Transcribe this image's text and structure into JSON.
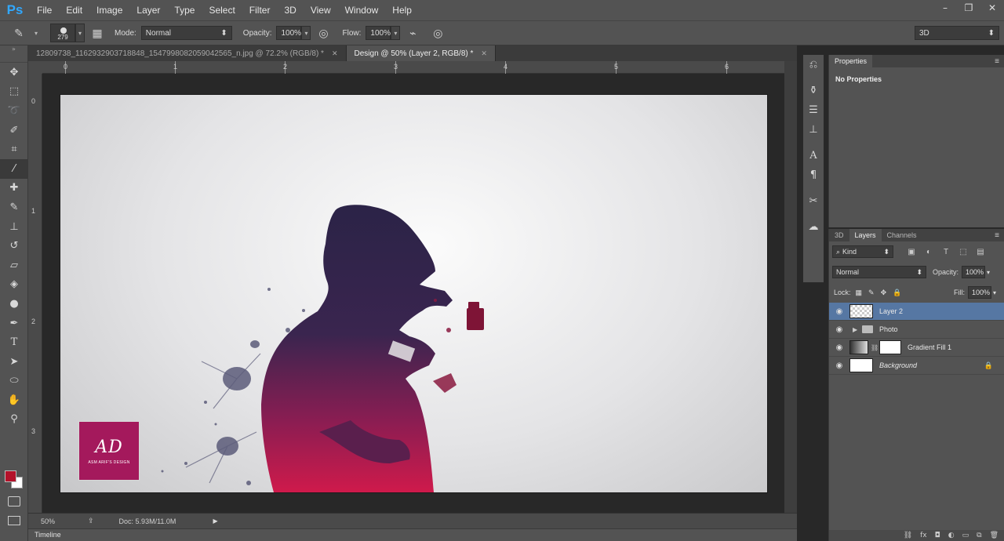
{
  "app": {
    "logo": "Ps"
  },
  "menu": [
    "File",
    "Edit",
    "Image",
    "Layer",
    "Type",
    "Select",
    "Filter",
    "3D",
    "View",
    "Window",
    "Help"
  ],
  "window_controls": {
    "minimize": "–",
    "restore": "❐",
    "close": "✕"
  },
  "options": {
    "brush_size": "279",
    "mode_label": "Mode:",
    "mode_value": "Normal",
    "opacity_label": "Opacity:",
    "opacity_value": "100%",
    "flow_label": "Flow:",
    "flow_value": "100%",
    "workspace": "3D"
  },
  "doc_tabs": [
    {
      "label": "12809738_1162932903718848_1547998082059042565_n.jpg @ 72.2% (RGB/8) *",
      "active": false
    },
    {
      "label": "Design @ 50% (Layer 2, RGB/8) *",
      "active": true
    }
  ],
  "rulers": {
    "h": [
      "0",
      "1",
      "2",
      "3",
      "4",
      "5",
      "6"
    ],
    "v": [
      "0",
      "1",
      "2",
      "3"
    ]
  },
  "canvas": {
    "logo_mark": "AD",
    "logo_text": "ASM ARIF'S DESIGN",
    "colors": {
      "dark": "#2f2449",
      "magenta": "#c2184e",
      "splash": "#5a5a78"
    }
  },
  "status": {
    "zoom": "50%",
    "doc_info": "Doc: 5.93M/11.0M"
  },
  "timeline_label": "Timeline",
  "tools": [
    "move-icon",
    "marquee-icon",
    "lasso-icon",
    "quick-select-icon",
    "crop-icon",
    "eyedropper-icon",
    "healing-brush-icon",
    "brush-icon",
    "clone-stamp-icon",
    "history-brush-icon",
    "eraser-icon",
    "paint-bucket-icon",
    "dodge-icon",
    "pen-icon",
    "type-icon",
    "path-select-icon",
    "ellipse-icon",
    "hand-icon",
    "zoom-icon"
  ],
  "colors": {
    "foreground": "#b3122a",
    "background": "#ffffff"
  },
  "properties": {
    "tab": "Properties",
    "empty_text": "No Properties"
  },
  "layers_panel": {
    "tabs": [
      "3D",
      "Layers",
      "Channels"
    ],
    "filter_kind": "Kind",
    "blend_mode": "Normal",
    "opacity_label": "Opacity:",
    "opacity_value": "100%",
    "lock_label": "Lock:",
    "fill_label": "Fill:",
    "fill_value": "100%",
    "layers": [
      {
        "name": "Layer 2",
        "selected": true
      },
      {
        "name": "Photo",
        "selected": false
      },
      {
        "name": "Gradient Fill 1",
        "selected": false
      },
      {
        "name": "Background",
        "selected": false
      }
    ]
  }
}
